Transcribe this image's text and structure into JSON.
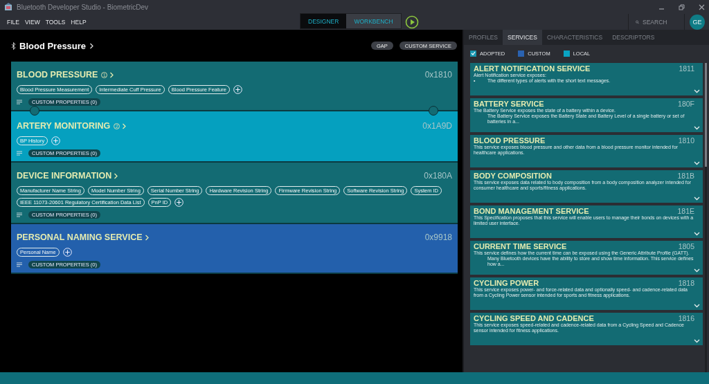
{
  "window": {
    "title": "Bluetooth Developer Studio - BiometricDev"
  },
  "menu": [
    "FILE",
    "VIEW",
    "TOOLS",
    "HELP"
  ],
  "mode_tabs": [
    {
      "label": "DESIGNER",
      "selected": true
    },
    {
      "label": "WORKBENCH",
      "selected": false
    }
  ],
  "search": {
    "placeholder": "SEARCH"
  },
  "user": {
    "initials": "GE"
  },
  "profile": {
    "title": "Blood Pressure",
    "buttons": [
      "GAP",
      "CUSTOM SERVICE"
    ]
  },
  "services": [
    {
      "name": "BLOOD PRESSURE",
      "badge": "1",
      "uuid": "0x1810",
      "kind": "adopted",
      "characteristics": [
        "Blood Pressure Measurement",
        "Intermediate Cuff Pressure",
        "Blood Pressure Feature"
      ],
      "custom_properties": "CUSTOM PROPERTIES (0)",
      "linked_to_next": true
    },
    {
      "name": "ARTERY MONITORING",
      "badge": "2",
      "uuid": "0x1A9D",
      "kind": "local",
      "characteristics": [
        "BP History"
      ],
      "custom_properties": "CUSTOM PROPERTIES (0)",
      "linked_to_next": false
    },
    {
      "name": "DEVICE INFORMATION",
      "uuid": "0x180A",
      "kind": "adopted",
      "characteristics": [
        "Manufacturer Name String",
        "Model Number String",
        "Serial Number String",
        "Hardware Revision String",
        "Firmware Revision String",
        "Software Revision String",
        "System ID",
        "IEEE 11073-20601 Regulatory Certification Data List",
        "PnP ID"
      ],
      "custom_properties": "CUSTOM PROPERTIES (0)",
      "linked_to_next": false
    },
    {
      "name": "PERSONAL NAMING SERVICE",
      "uuid": "0x9918",
      "kind": "custom",
      "characteristics": [
        "Personal Name"
      ],
      "custom_properties": "CUSTOM PROPERTIES (0)",
      "linked_to_next": false
    }
  ],
  "panel": {
    "tabs": [
      {
        "label": "PROFILES",
        "selected": false
      },
      {
        "label": "SERVICES",
        "selected": true
      },
      {
        "label": "CHARACTERISTICS",
        "selected": false
      },
      {
        "label": "DESCRIPTORS",
        "selected": false
      }
    ],
    "legend": [
      {
        "kind": "checkbox",
        "label": "ADOPTED",
        "checked": true
      },
      {
        "kind": "swatch",
        "label": "CUSTOM",
        "color": "#2a62b0"
      },
      {
        "kind": "swatch",
        "label": "LOCAL",
        "color": "#0aa3c2"
      }
    ],
    "catalog": [
      {
        "name": "ALERT NOTIFICATION SERVICE",
        "uuid": "1811",
        "lines": [
          {
            "kind": "plain",
            "text": "Alert Notification service exposes:"
          },
          {
            "kind": "bullet",
            "bullet": "•",
            "text": "The different types of alerts with the short text messages."
          }
        ]
      },
      {
        "name": "BATTERY SERVICE",
        "uuid": "180F",
        "lines": [
          {
            "kind": "plain",
            "text": "The Battery Service exposes the state of a battery within a device."
          },
          {
            "kind": "indent",
            "text": "The Battery Service exposes the Battery State and Battery Level of a single battery or set of batteries in a..."
          }
        ]
      },
      {
        "name": "BLOOD PRESSURE",
        "uuid": "1810",
        "lines": [
          {
            "kind": "plain",
            "text": "This service exposes blood pressure and other data from a blood pressure monitor intended for healthcare applications."
          }
        ]
      },
      {
        "name": "BODY COMPOSITION",
        "uuid": "181B",
        "lines": [
          {
            "kind": "plain",
            "text": "This service exposes data related to body composition from a body composition analyzer intended for consumer healthcare and sports/fitness applications."
          }
        ]
      },
      {
        "name": "BOND MANAGEMENT SERVICE",
        "uuid": "181E",
        "lines": [
          {
            "kind": "plain",
            "text": "This Specification proposes that this service will enable users to manage their bonds on devices with a limited user interface."
          }
        ]
      },
      {
        "name": "CURRENT TIME SERVICE",
        "uuid": "1805",
        "lines": [
          {
            "kind": "plain",
            "text": "This service defines how the current time can be exposed using the Generic Attribute Profile (GATT)."
          },
          {
            "kind": "indent",
            "text": "Many Bluetooth devices have the ability to store and show time information. This service defines how a..."
          }
        ]
      },
      {
        "name": "CYCLING POWER",
        "uuid": "1818",
        "lines": [
          {
            "kind": "plain",
            "text": "This service exposes power- and force-related data and optionally speed- and cadence-related data from a Cycling Power sensor intended for sports and fitness applications."
          }
        ]
      },
      {
        "name": "CYCLING SPEED AND CADENCE",
        "uuid": "1816",
        "lines": [
          {
            "kind": "plain",
            "text": "This service exposes speed-related and cadence-related data from a Cycling Speed and Cadence sensor intended for fitness applications."
          }
        ]
      }
    ]
  }
}
